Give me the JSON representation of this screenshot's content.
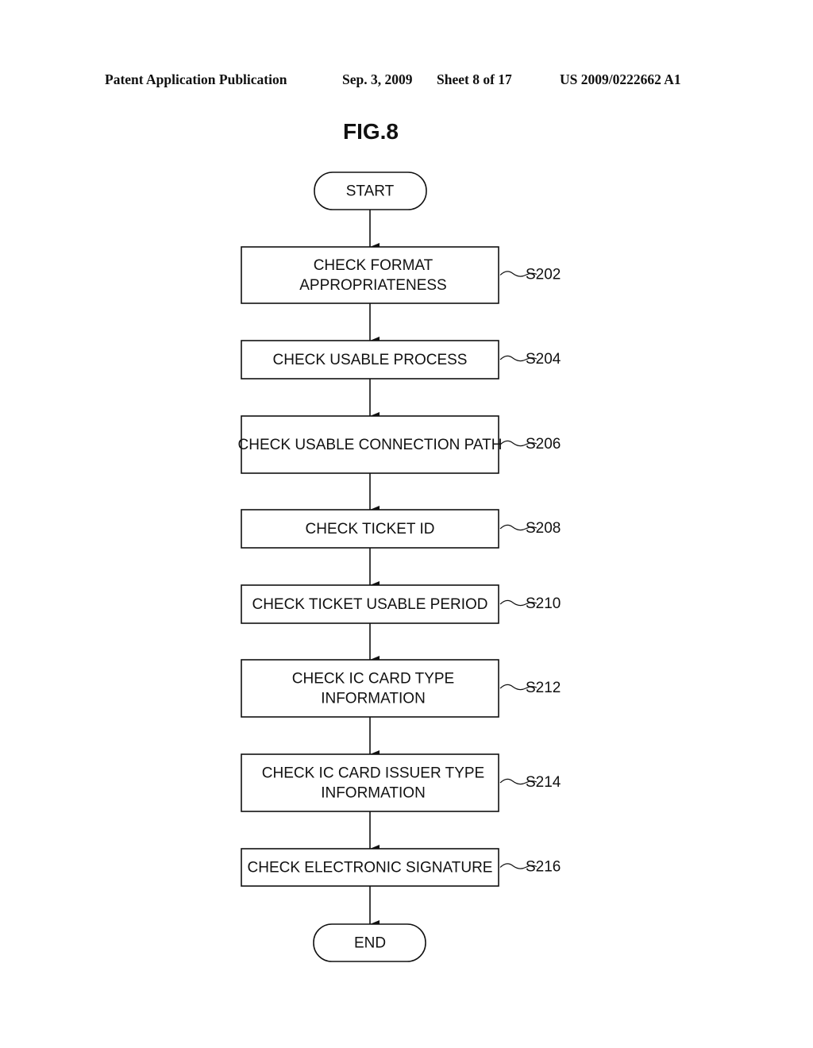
{
  "header": {
    "publication": "Patent Application Publication",
    "date": "Sep. 3, 2009",
    "sheet": "Sheet 8 of 17",
    "number": "US 2009/0222662 A1"
  },
  "figure": {
    "title": "FIG.8",
    "start_label": "START",
    "end_label": "END",
    "steps": [
      {
        "id": "S202",
        "lines": [
          "CHECK FORMAT",
          "APPROPRIATENESS"
        ]
      },
      {
        "id": "S204",
        "lines": [
          "CHECK USABLE PROCESS"
        ]
      },
      {
        "id": "S206",
        "lines": [
          "CHECK USABLE CONNECTION PATH"
        ]
      },
      {
        "id": "S208",
        "lines": [
          "CHECK TICKET ID"
        ]
      },
      {
        "id": "S210",
        "lines": [
          "CHECK TICKET USABLE PERIOD"
        ]
      },
      {
        "id": "S212",
        "lines": [
          "CHECK IC CARD TYPE",
          "INFORMATION"
        ]
      },
      {
        "id": "S214",
        "lines": [
          "CHECK IC CARD ISSUER TYPE",
          "INFORMATION"
        ]
      },
      {
        "id": "S216",
        "lines": [
          "CHECK ELECTRONIC SIGNATURE"
        ]
      }
    ]
  }
}
